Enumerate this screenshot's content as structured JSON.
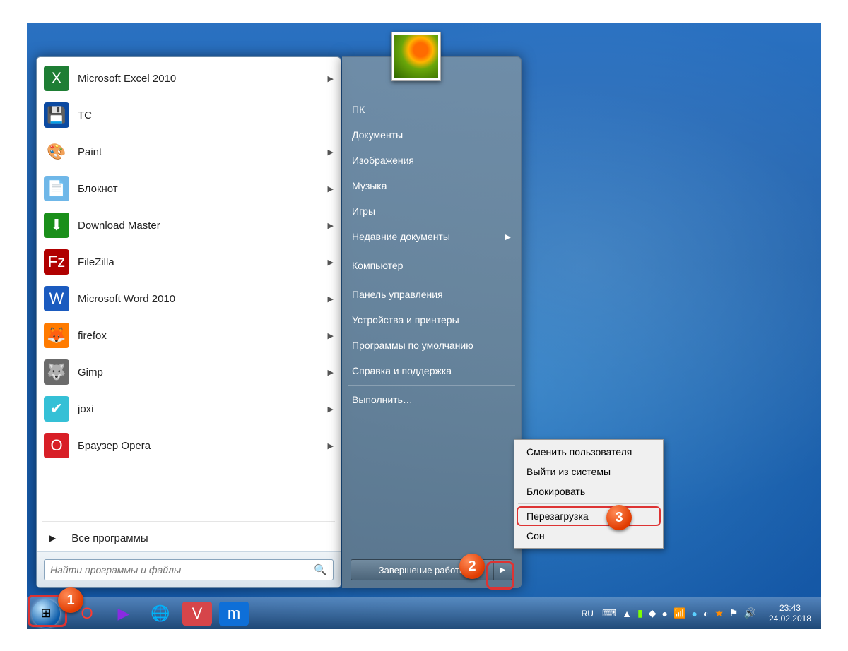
{
  "apps": [
    {
      "label": "Microsoft Excel 2010",
      "icon": "X",
      "bg": "#1e7e34",
      "arrow": true
    },
    {
      "label": "TC",
      "icon": "💾",
      "bg": "#0b4aa2",
      "arrow": false
    },
    {
      "label": "Paint",
      "icon": "🎨",
      "bg": "#fff",
      "arrow": true
    },
    {
      "label": "Блокнот",
      "icon": "📄",
      "bg": "#6fb7e8",
      "arrow": true
    },
    {
      "label": "Download Master",
      "icon": "⬇",
      "bg": "#1a8f1a",
      "arrow": true
    },
    {
      "label": "FileZilla",
      "icon": "Fz",
      "bg": "#b00000",
      "arrow": true
    },
    {
      "label": "Microsoft Word 2010",
      "icon": "W",
      "bg": "#1b5bbf",
      "arrow": true
    },
    {
      "label": "firefox",
      "icon": "🦊",
      "bg": "#ff7b00",
      "arrow": true
    },
    {
      "label": "Gimp",
      "icon": "🐺",
      "bg": "#6b6b6b",
      "arrow": true
    },
    {
      "label": "joxi",
      "icon": "✔",
      "bg": "#35c0d6",
      "arrow": true
    },
    {
      "label": "Браузер Opera",
      "icon": "O",
      "bg": "#d81f27",
      "arrow": true
    }
  ],
  "all_programs": "Все программы",
  "search_placeholder": "Найти программы и файлы",
  "right_items_a": [
    "ПК",
    "Документы",
    "Изображения",
    "Музыка",
    "Игры"
  ],
  "right_recent": "Недавние документы",
  "right_items_b": [
    "Компьютер"
  ],
  "right_items_c": [
    "Панель управления",
    "Устройства и принтеры",
    "Программы по умолчанию",
    "Справка и поддержка"
  ],
  "right_run": "Выполнить…",
  "shutdown_label": "Завершение работы",
  "submenu": {
    "switch": "Сменить пользователя",
    "logoff": "Выйти из системы",
    "lock": "Блокировать",
    "restart": "Перезагрузка",
    "sleep": "Сон"
  },
  "lang": "RU",
  "clock_time": "23:43",
  "clock_date": "24.02.2018",
  "markers": {
    "1": "1",
    "2": "2",
    "3": "3"
  }
}
